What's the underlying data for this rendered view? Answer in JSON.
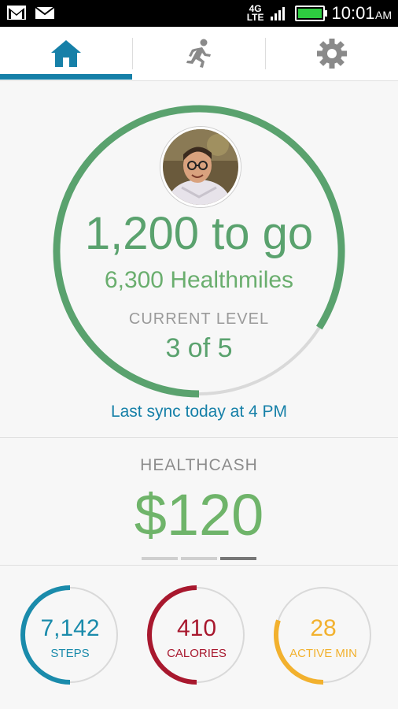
{
  "status_bar": {
    "time": "10:01",
    "ampm": "AM",
    "network": "4G",
    "network_sub": "LTE",
    "icons": [
      "gmail-icon",
      "mail-icon",
      "signal-icon",
      "battery-icon"
    ]
  },
  "tabs": [
    {
      "name": "home",
      "icon": "home-icon",
      "active": true
    },
    {
      "name": "activity",
      "icon": "running-icon",
      "active": false
    },
    {
      "name": "settings",
      "icon": "gear-icon",
      "active": false
    }
  ],
  "summary": {
    "to_go": "1,200 to go",
    "healthmiles": "6,300 Healthmiles",
    "level_label": "CURRENT LEVEL",
    "level_value": "3 of 5",
    "progress": 0.84,
    "sync": "Last sync today at 4 PM"
  },
  "healthcash": {
    "label": "HEALTHCASH",
    "value": "$120",
    "pager": [
      false,
      false,
      true
    ]
  },
  "stats": [
    {
      "value": "7,142",
      "label": "STEPS",
      "color": "#1a8bab",
      "progress": 0.5
    },
    {
      "value": "410",
      "label": "CALORIES",
      "color": "#a8182e",
      "progress": 0.5
    },
    {
      "value": "28",
      "label": "ACTIVE MIN",
      "color": "#f2b12e",
      "progress": 0.3
    }
  ],
  "colors": {
    "accent": "#1680a8",
    "green": "#5aa26e",
    "track": "#d9d9d9"
  }
}
